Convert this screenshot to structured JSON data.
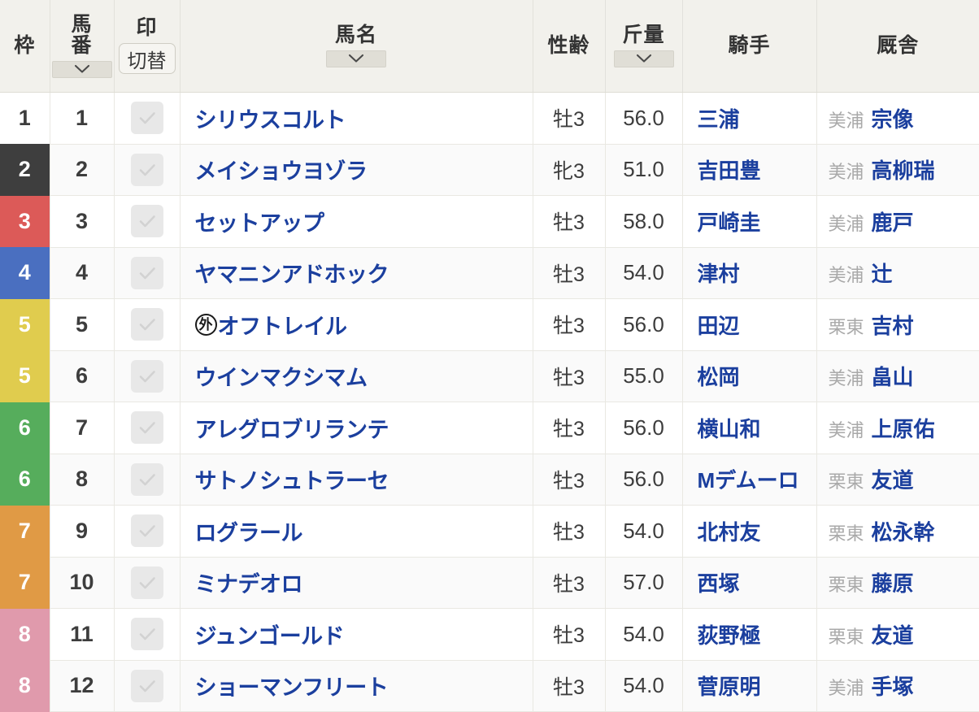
{
  "table": {
    "columns": [
      {
        "key": "waku",
        "label": "枠",
        "sortable": false
      },
      {
        "key": "umaban",
        "label": "馬\n番",
        "sortable": true
      },
      {
        "key": "mark",
        "label": "印",
        "sortable": false,
        "toggle_label": "切替"
      },
      {
        "key": "bamei",
        "label": "馬名",
        "sortable": true
      },
      {
        "key": "seirei",
        "label": "性齢",
        "sortable": false
      },
      {
        "key": "kinryo",
        "label": "斤量",
        "sortable": true
      },
      {
        "key": "kishu",
        "label": "騎手",
        "sortable": false
      },
      {
        "key": "kyusha",
        "label": "厩舎",
        "sortable": false
      }
    ]
  },
  "waku_colors": {
    "1": {
      "bg": "#ffffff",
      "fg": "#3d3d3d"
    },
    "2": {
      "bg": "#3e3e3e",
      "fg": "#ffffff"
    },
    "3": {
      "bg": "#dc5a58",
      "fg": "#ffffff"
    },
    "4": {
      "bg": "#4a6fc0",
      "fg": "#ffffff"
    },
    "5": {
      "bg": "#e0cc4e",
      "fg": "#ffffff"
    },
    "6": {
      "bg": "#56ad5c",
      "fg": "#ffffff"
    },
    "7": {
      "bg": "#e09a45",
      "fg": "#ffffff"
    },
    "8": {
      "bg": "#e09aac",
      "fg": "#ffffff"
    }
  },
  "rows": [
    {
      "waku": "1",
      "umaban": "1",
      "checked": false,
      "gai": "",
      "bamei": "シリウスコルト",
      "seirei": "牡3",
      "kinryo": "56.0",
      "kishu": "三浦",
      "belong": "美浦",
      "trainer": "宗像"
    },
    {
      "waku": "2",
      "umaban": "2",
      "checked": false,
      "gai": "",
      "bamei": "メイショウヨゾラ",
      "seirei": "牝3",
      "kinryo": "51.0",
      "kishu": "吉田豊",
      "belong": "美浦",
      "trainer": "高柳瑞"
    },
    {
      "waku": "3",
      "umaban": "3",
      "checked": false,
      "gai": "",
      "bamei": "セットアップ",
      "seirei": "牡3",
      "kinryo": "58.0",
      "kishu": "戸崎圭",
      "belong": "美浦",
      "trainer": "鹿戸"
    },
    {
      "waku": "4",
      "umaban": "4",
      "checked": false,
      "gai": "",
      "bamei": "ヤマニンアドホック",
      "seirei": "牡3",
      "kinryo": "54.0",
      "kishu": "津村",
      "belong": "美浦",
      "trainer": "辻"
    },
    {
      "waku": "5",
      "umaban": "5",
      "checked": false,
      "gai": "外",
      "bamei": "オフトレイル",
      "seirei": "牡3",
      "kinryo": "56.0",
      "kishu": "田辺",
      "belong": "栗東",
      "trainer": "吉村"
    },
    {
      "waku": "5",
      "umaban": "6",
      "checked": false,
      "gai": "",
      "bamei": "ウインマクシマム",
      "seirei": "牡3",
      "kinryo": "55.0",
      "kishu": "松岡",
      "belong": "美浦",
      "trainer": "畠山"
    },
    {
      "waku": "6",
      "umaban": "7",
      "checked": false,
      "gai": "",
      "bamei": "アレグロブリランテ",
      "seirei": "牡3",
      "kinryo": "56.0",
      "kishu": "横山和",
      "belong": "美浦",
      "trainer": "上原佑"
    },
    {
      "waku": "6",
      "umaban": "8",
      "checked": false,
      "gai": "",
      "bamei": "サトノシュトラーセ",
      "seirei": "牡3",
      "kinryo": "56.0",
      "kishu": "Mデムーロ",
      "belong": "栗東",
      "trainer": "友道"
    },
    {
      "waku": "7",
      "umaban": "9",
      "checked": false,
      "gai": "",
      "bamei": "ログラール",
      "seirei": "牡3",
      "kinryo": "54.0",
      "kishu": "北村友",
      "belong": "栗東",
      "trainer": "松永幹"
    },
    {
      "waku": "7",
      "umaban": "10",
      "checked": false,
      "gai": "",
      "bamei": "ミナデオロ",
      "seirei": "牡3",
      "kinryo": "57.0",
      "kishu": "西塚",
      "belong": "栗東",
      "trainer": "藤原"
    },
    {
      "waku": "8",
      "umaban": "11",
      "checked": false,
      "gai": "",
      "bamei": "ジュンゴールド",
      "seirei": "牡3",
      "kinryo": "54.0",
      "kishu": "荻野極",
      "belong": "栗東",
      "trainer": "友道"
    },
    {
      "waku": "8",
      "umaban": "12",
      "checked": false,
      "gai": "",
      "bamei": "ショーマンフリート",
      "seirei": "牡3",
      "kinryo": "54.0",
      "kishu": "菅原明",
      "belong": "美浦",
      "trainer": "手塚"
    }
  ]
}
